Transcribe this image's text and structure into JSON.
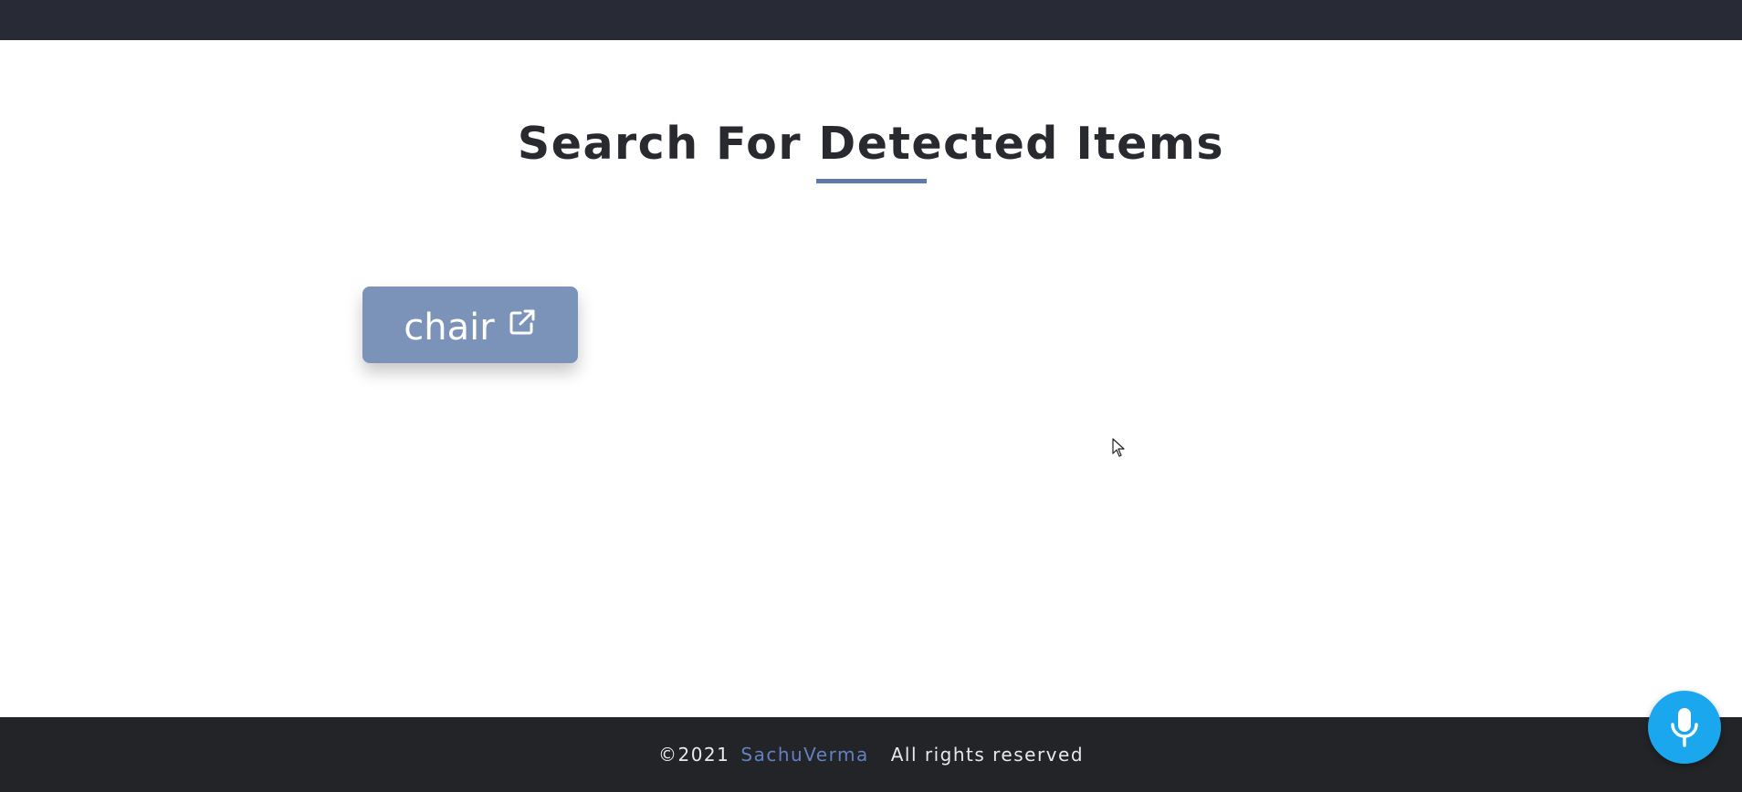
{
  "header": {
    "bar_color": "#282b35"
  },
  "main": {
    "title": "Search For Detected Items",
    "accent_color": "#5f7aaa",
    "items": [
      {
        "label": "chair",
        "icon": "external-link-icon",
        "color": "#7b93b8"
      }
    ]
  },
  "footer": {
    "copyright": "©2021",
    "author": "SachuVerma",
    "rights": "All rights reserved",
    "author_color": "#6381c1"
  },
  "mic_button": {
    "icon": "microphone-icon",
    "color": "#1ba7ee"
  }
}
